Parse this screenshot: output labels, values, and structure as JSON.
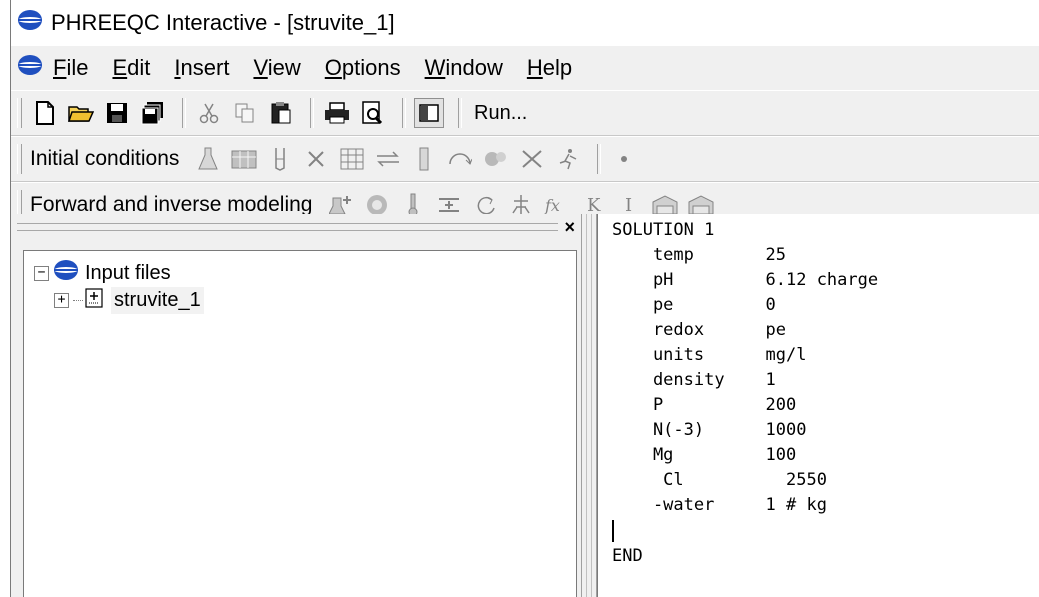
{
  "window": {
    "title": "PHREEQC Interactive - [struvite_1]"
  },
  "menu": [
    {
      "mn": "F",
      "rest": "ile"
    },
    {
      "mn": "E",
      "rest": "dit"
    },
    {
      "mn": "I",
      "rest": "nsert"
    },
    {
      "mn": "V",
      "rest": "iew"
    },
    {
      "mn": "O",
      "rest": "ptions"
    },
    {
      "mn": "W",
      "rest": "indow"
    },
    {
      "mn": "H",
      "rest": "elp"
    }
  ],
  "toolbar_main": {
    "run_label": "Run..."
  },
  "toolbar_initial": {
    "label": "Initial conditions"
  },
  "toolbar_modeling": {
    "label": "Forward and inverse modeling"
  },
  "tree": {
    "root_label": "Input files",
    "child_label": "struvite_1"
  },
  "editor": {
    "lines": [
      "SOLUTION 1",
      "    temp       25",
      "    pH         6.12 charge",
      "    pe         0",
      "    redox      pe",
      "    units      mg/l",
      "    density    1",
      "    P          200",
      "    N(-3)      1000",
      "    Mg         100",
      "     Cl          2550",
      "    -water     1 # kg",
      "",
      "END"
    ]
  }
}
